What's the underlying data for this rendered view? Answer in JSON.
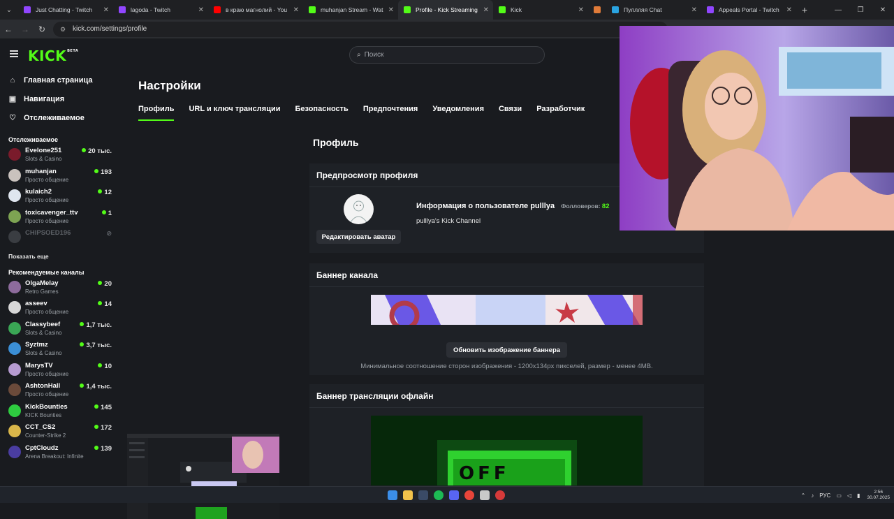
{
  "browser": {
    "tabs": [
      {
        "title": "Just Chatting - Twitch",
        "favicon_color": "#9146ff"
      },
      {
        "title": "lagoda - Twitch",
        "favicon_color": "#9146ff"
      },
      {
        "title": "в краю магнолий - You",
        "favicon_color": "#ff0000"
      },
      {
        "title": "muhanjan Stream - Wat",
        "favicon_color": "#53fc18"
      },
      {
        "title": "Profile - Kick Streaming",
        "favicon_color": "#53fc18",
        "active": true
      },
      {
        "title": "Kick",
        "favicon_color": "#53fc18"
      },
      {
        "title": "",
        "favicon_color": "#e07b39"
      },
      {
        "title": "Пуллляя Chat",
        "favicon_color": "#2aa3e0"
      },
      {
        "title": "Appeals Portal - Twitch",
        "favicon_color": "#9146ff"
      }
    ],
    "new_tab": "+",
    "url": "kick.com/settings/profile"
  },
  "header": {
    "logo": "KICK",
    "logo_badge": "BETA",
    "search_placeholder": "Поиск"
  },
  "sidebar": {
    "nav": [
      {
        "label": "Главная страница",
        "icon": "home-icon",
        "glyph": "⌂"
      },
      {
        "label": "Навигация",
        "icon": "browse-icon",
        "glyph": "▣"
      },
      {
        "label": "Отслеживаемое",
        "icon": "heart-icon",
        "glyph": "♡"
      }
    ],
    "following_title": "Отслеживаемое",
    "following": [
      {
        "name": "Evelone251",
        "category": "Slots & Casino",
        "viewers": "20 тыс.",
        "color": "#7a1b2b"
      },
      {
        "name": "muhanjan",
        "category": "Просто общение",
        "viewers": "193",
        "color": "#c9c2bd"
      },
      {
        "name": "kulaich2",
        "category": "Просто общение",
        "viewers": "12",
        "color": "#dfe6ef"
      },
      {
        "name": "toxicavenger_ttv",
        "category": "Просто общение",
        "viewers": "1",
        "color": "#7da352"
      },
      {
        "name": "CHIPSOED196",
        "category": "",
        "viewers": "",
        "color": "#3a3d42",
        "offline": true
      }
    ],
    "show_more": "Показать еще",
    "recommended_title": "Рекомендуемые каналы",
    "recommended": [
      {
        "name": "OlgaMelay",
        "category": "Retro Games",
        "viewers": "20",
        "color": "#8d6b9c"
      },
      {
        "name": "asseev",
        "category": "Просто общение",
        "viewers": "14",
        "color": "#d7d7d7"
      },
      {
        "name": "Classybeef",
        "category": "Slots & Casino",
        "viewers": "1,7 тыс.",
        "color": "#3aa655"
      },
      {
        "name": "Syztmz",
        "category": "Slots & Casino",
        "viewers": "3,7 тыс.",
        "color": "#3b8fd6"
      },
      {
        "name": "MarysTV",
        "category": "Просто общение",
        "viewers": "10",
        "color": "#b69bd1"
      },
      {
        "name": "AshtonHall",
        "category": "Просто общение",
        "viewers": "1,4 тыс.",
        "color": "#6b4a3a"
      },
      {
        "name": "KickBounties",
        "category": "KICK Bounties",
        "viewers": "145",
        "color": "#2ecc40"
      },
      {
        "name": "CCT_CS2",
        "category": "Counter-Strike 2",
        "viewers": "172",
        "color": "#d9b64a"
      },
      {
        "name": "CptCloudz",
        "category": "Arena Breakout: Infinite",
        "viewers": "139",
        "color": "#4a3da1"
      }
    ]
  },
  "settings": {
    "title": "Настройки",
    "tabs": [
      "Профиль",
      "URL и ключ трансляции",
      "Безопасность",
      "Предпочтения",
      "Уведомления",
      "Связи",
      "Разработчик"
    ],
    "section_title": "Профиль",
    "preview": {
      "title": "Предпросмотр профиля",
      "edit_avatar": "Редактировать аватар",
      "user_info": "Информация о пользователе pulllya",
      "followers_label": "Фолловеров:",
      "followers_value": "82",
      "channel_name": "pulllya's Kick Channel"
    },
    "banner": {
      "title": "Баннер канала",
      "update_button": "Обновить изображение баннера",
      "hint": "Минимальное соотношение сторон изображения - 1200x134px пикселей, размер - менее 4MB."
    },
    "offline_banner": {
      "title": "Баннер трансляции офлайн",
      "image_text": "OFF"
    }
  },
  "taskbar": {
    "lang": "РУС",
    "time": "2:56",
    "date": "30.07.2025"
  }
}
